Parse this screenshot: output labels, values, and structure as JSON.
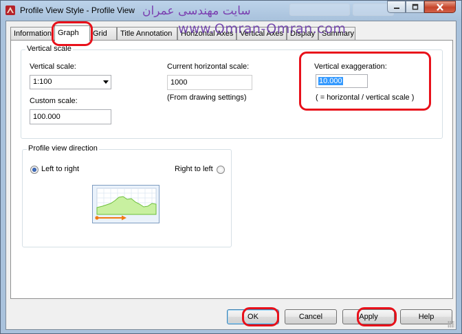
{
  "window": {
    "title": "Profile View Style - Profile View",
    "watermark_arabic": "سایت مهندسی عمران",
    "watermark_url": "www.Omran-Omran.com"
  },
  "tabs": [
    {
      "label": "Information",
      "active": false
    },
    {
      "label": "Graph",
      "active": true
    },
    {
      "label": "Grid",
      "active": false
    },
    {
      "label": "Title Annotation",
      "active": false
    },
    {
      "label": "Horizontal Axes",
      "active": false
    },
    {
      "label": "Vertical Axes",
      "active": false
    },
    {
      "label": "Display",
      "active": false
    },
    {
      "label": "Summary",
      "active": false
    }
  ],
  "vertical_scale": {
    "group_title": "Vertical scale",
    "vertical_scale_label": "Vertical scale:",
    "vertical_scale_value": "1:100",
    "custom_scale_label": "Custom scale:",
    "custom_scale_value": "100.000",
    "current_horizontal_label": "Current horizontal scale:",
    "current_horizontal_value": "1000",
    "from_drawing_note": "(From drawing settings)",
    "vertical_exaggeration_label": "Vertical exaggeration:",
    "vertical_exaggeration_value": "10.000",
    "exaggeration_note": "( = horizontal / vertical scale )"
  },
  "direction": {
    "group_title": "Profile view direction",
    "left_to_right_label": "Left to right",
    "left_to_right_selected": true,
    "right_to_left_label": "Right to left",
    "right_to_left_selected": false
  },
  "buttons": {
    "ok": "OK",
    "cancel": "Cancel",
    "apply": "Apply",
    "help": "Help"
  },
  "colors": {
    "annotation_red": "#e8101a",
    "selection_blue": "#3399ff",
    "profile_fill": "#c8f0a0",
    "direction_arrow": "#f07a12"
  },
  "icons": {
    "app": "civil-3d-icon",
    "minimize": "minimize-icon",
    "maximize": "maximize-icon",
    "close": "close-icon",
    "dropdown": "chevron-down-icon",
    "preview": "profile-view-preview-icon"
  }
}
